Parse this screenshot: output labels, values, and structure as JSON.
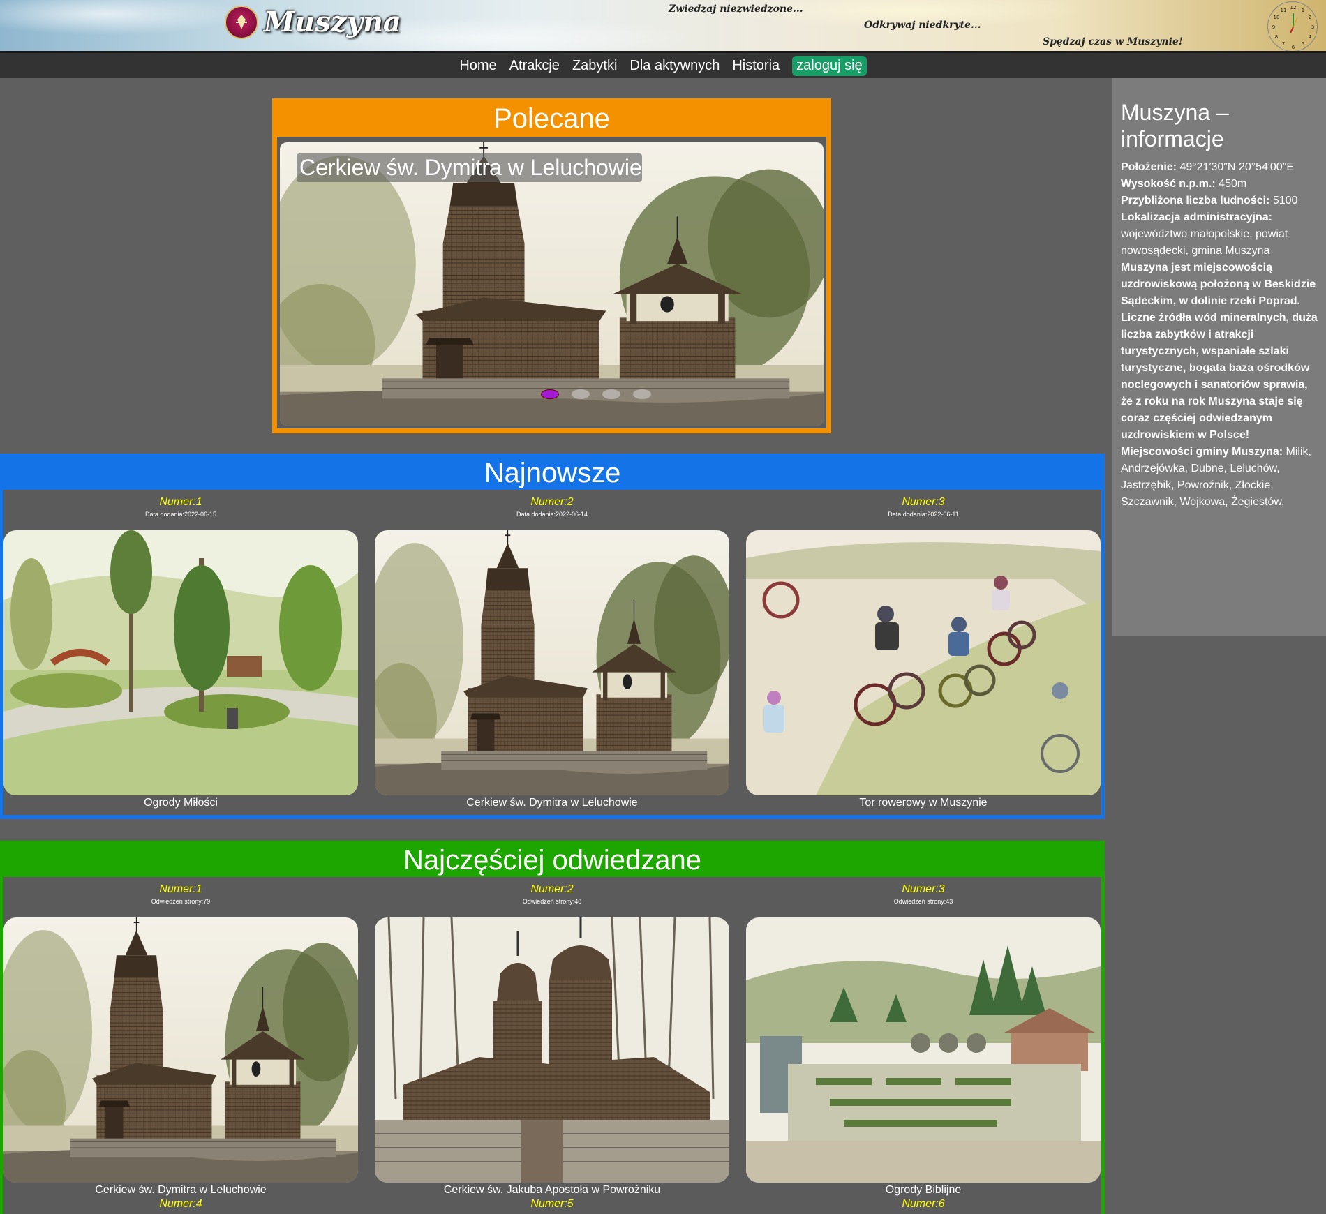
{
  "header": {
    "brand": "Muszyna",
    "slogan1": "Zwiedzaj niezwiedzone...",
    "slogan2": "Odkrywaj niedkryte...",
    "slogan3": "Spędzaj czas w Muszynie!",
    "logo_icon": "crest-icon",
    "clock_icon": "clock-icon"
  },
  "nav": {
    "home": "Home",
    "atrakcje": "Atrakcje",
    "zabytki": "Zabytki",
    "aktywni": "Dla aktywnych",
    "historia": "Historia",
    "login": "zaloguj się"
  },
  "polecane": {
    "title": "Polecane",
    "caption": "Cerkiew św. Dymitra w Leluchowie",
    "dots": 4,
    "active_dot": 1
  },
  "najnowsze": {
    "title": "Najnowsze",
    "items": [
      {
        "num": "Numer:1",
        "meta": "Data dodania:2022-06-15",
        "caption": "Ogrody Miłości"
      },
      {
        "num": "Numer:2",
        "meta": "Data dodania:2022-06-14",
        "caption": "Cerkiew św. Dymitra w Leluchowie"
      },
      {
        "num": "Numer:3",
        "meta": "Data dodania:2022-06-11",
        "caption": "Tor rowerowy w Muszynie"
      }
    ]
  },
  "odwiedzane": {
    "title": "Najczęściej odwiedzane",
    "items": [
      {
        "num": "Numer:1",
        "meta": "Odwiedzeń strony:79",
        "caption": "Cerkiew św. Dymitra w Leluchowie",
        "next": "Numer:4"
      },
      {
        "num": "Numer:2",
        "meta": "Odwiedzeń strony:48",
        "caption": "Cerkiew św. Jakuba Apostoła w Powrożniku",
        "next": "Numer:5"
      },
      {
        "num": "Numer:3",
        "meta": "Odwiedzeń strony:43",
        "caption": "Ogrody Biblijne",
        "next": "Numer:6"
      }
    ]
  },
  "sidebar": {
    "title": "Muszyna – informacje",
    "polozenie_label": "Położenie:",
    "polozenie": " 49°21′30″N 20°54′00″E",
    "wysokosc_label": "Wysokość n.p.m.:",
    "wysokosc": " 450m",
    "ludnosc_label": "Przybliżona liczba ludności:",
    "ludnosc": " 5100",
    "lokalizacja_label": "Lokalizacja administracyjna:",
    "lokalizacja": " województwo małopolskie, powiat nowosądecki, gmina Muszyna ",
    "opis": "Muszyna jest miejscowością uzdrowiskową położoną w Beskidzie Sądeckim, w dolinie rzeki Poprad. Liczne źródła wód mineralnych, duża liczba zabytków i atrakcji turystycznych, wspaniałe szlaki turystyczne, bogata baza ośrodków noclegowych i sanatoriów sprawia, że z roku na rok Muszyna staje się coraz częściej odwiedzanym uzdrowiskiem w Polsce!",
    "miejscowosci_label": "Miejscowości gminy Muszyna:",
    "miejscowosci": " Milik, Andrzejówka, Dubne, Leluchów, Jastrzębik, Powroźnik, Złockie, Szczawnik, Wojkowa, Żegiestów."
  }
}
